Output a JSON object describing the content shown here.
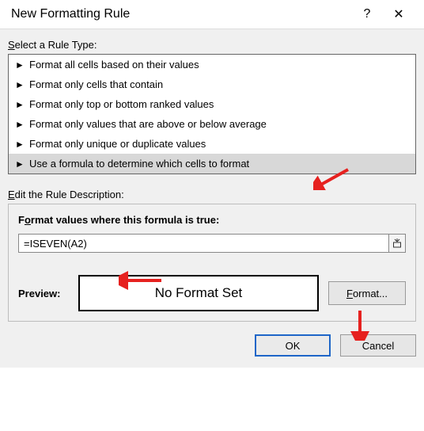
{
  "titlebar": {
    "title": "New Formatting Rule",
    "help_glyph": "?",
    "close_glyph": "✕"
  },
  "sections": {
    "select_label": "Select a Rule Type:",
    "edit_label": "Edit the Rule Description:"
  },
  "rule_types": [
    "Format all cells based on their values",
    "Format only cells that contain",
    "Format only top or bottom ranked values",
    "Format only values that are above or below average",
    "Format only unique or duplicate values",
    "Use a formula to determine which cells to format"
  ],
  "selected_rule_index": 5,
  "edit": {
    "formula_label": "Format values where this formula is true:",
    "formula_value": "=ISEVEN(A2)",
    "preview_label": "Preview:",
    "preview_text": "No Format Set",
    "format_btn": "Format..."
  },
  "footer": {
    "ok": "OK",
    "cancel": "Cancel"
  },
  "annotation_color": "#e6211f"
}
